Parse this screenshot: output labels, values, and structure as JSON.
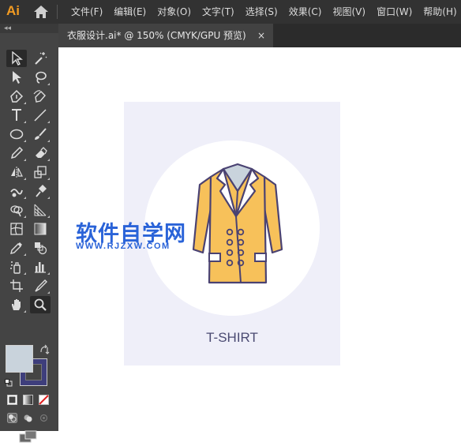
{
  "app": {
    "logo_text": "Ai",
    "home_icon": "home-icon"
  },
  "menu": {
    "items": [
      "文件(F)",
      "编辑(E)",
      "对象(O)",
      "文字(T)",
      "选择(S)",
      "效果(C)",
      "视图(V)",
      "窗口(W)",
      "帮助(H)"
    ]
  },
  "document_tab": {
    "title": "衣服设计.ai* @ 150% (CMYK/GPU 预览)",
    "close_glyph": "×"
  },
  "tool_panel": {
    "collapse_glyph": "◂◂",
    "tools": [
      "selection-tool",
      "magic-wand-tool",
      "direct-selection-tool",
      "lasso-tool",
      "pen-tool",
      "curvature-tool",
      "type-tool",
      "line-tool",
      "ellipse-tool",
      "paintbrush-tool",
      "pencil-tool",
      "eraser-tool",
      "reflect-tool",
      "scale-tool",
      "warp-tool",
      "puppet-warp-tool",
      "shape-builder-tool",
      "perspective-grid-tool",
      "mesh-tool",
      "gradient-tool",
      "eyedropper-tool",
      "blend-tool",
      "symbol-sprayer-tool",
      "column-graph-tool",
      "artboard-tool",
      "slice-tool",
      "hand-tool",
      "zoom-tool"
    ],
    "selected_tool": "zoom-tool",
    "fill_color": "#c9d3dc",
    "stroke_color": "#3e3e7c"
  },
  "artboard": {
    "background": "#efeff9",
    "label": "T-SHIRT",
    "coat_color": "#f7c15a",
    "outline_color": "#4a4272"
  },
  "watermark": {
    "title": "软件自学网",
    "url": "WWW.RJZXW.COM"
  }
}
